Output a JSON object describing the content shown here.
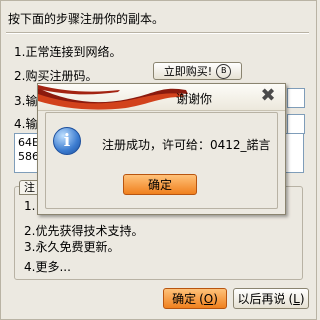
{
  "intro": "按下面的步骤注册你的副本。",
  "steps": {
    "s1": "1.正常连接到网络。",
    "s2": "2.购买注册码。",
    "s3": "3.输",
    "s4": "4.输"
  },
  "buy_button": {
    "label": "立即购买!",
    "key": "B"
  },
  "code_box": {
    "line1": "64E",
    "line2": "586"
  },
  "benefits": {
    "tab_label": "注",
    "b1": "1.",
    "b2": "2.优先获得技术支持。",
    "b3": "3.永久免费更新。",
    "b4": "4.更多..."
  },
  "footer": {
    "confirm_label": "确定",
    "confirm_key": "O",
    "later_label": "以后再说",
    "later_key": "L"
  },
  "dialog": {
    "title": "谢谢你",
    "close_glyph": "✖",
    "icon_glyph": "i",
    "message": "注册成功，许可给：0412_諾言",
    "ok_label": "确定"
  },
  "colors": {
    "accent_orange": "#f0801e",
    "ribbon_dark": "#8b1a0e",
    "ribbon_red": "#d2421c"
  }
}
